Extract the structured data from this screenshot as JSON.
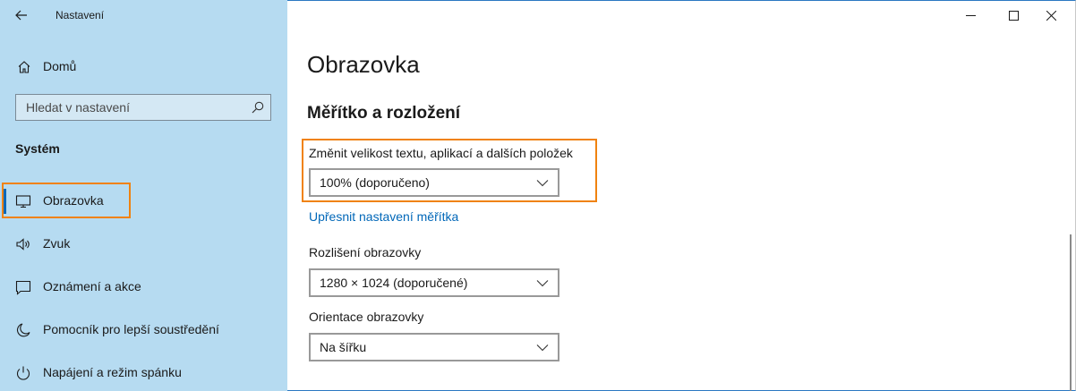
{
  "window": {
    "app_title": "Nastavení",
    "controls": [
      "minimize",
      "maximize",
      "close"
    ]
  },
  "sidebar": {
    "home_label": "Domů",
    "search_placeholder": "Hledat v nastavení",
    "section_title": "Systém",
    "items": [
      {
        "label": "Obrazovka",
        "icon": "monitor-icon",
        "active": true
      },
      {
        "label": "Zvuk",
        "icon": "speaker-icon"
      },
      {
        "label": "Oznámení a akce",
        "icon": "notification-icon"
      },
      {
        "label": "Pomocník pro lepší soustředění",
        "icon": "moon-icon"
      },
      {
        "label": "Napájení a režim spánku",
        "icon": "power-icon"
      }
    ]
  },
  "main": {
    "page_title": "Obrazovka",
    "section_title": "Měřítko a rozložení",
    "scale": {
      "label": "Změnit velikost textu, aplikací a dalších položek",
      "value": "100% (doporučeno)"
    },
    "advanced_link": "Upřesnit nastavení měřítka",
    "resolution": {
      "label": "Rozlišení obrazovky",
      "value": "1280 × 1024 (doporučené)"
    },
    "orientation": {
      "label": "Orientace obrazovky",
      "value": "Na šířku"
    }
  },
  "colors": {
    "sidebar_bg": "#b6dbf1",
    "accent": "#0067b8",
    "highlight": "#f0820f"
  }
}
